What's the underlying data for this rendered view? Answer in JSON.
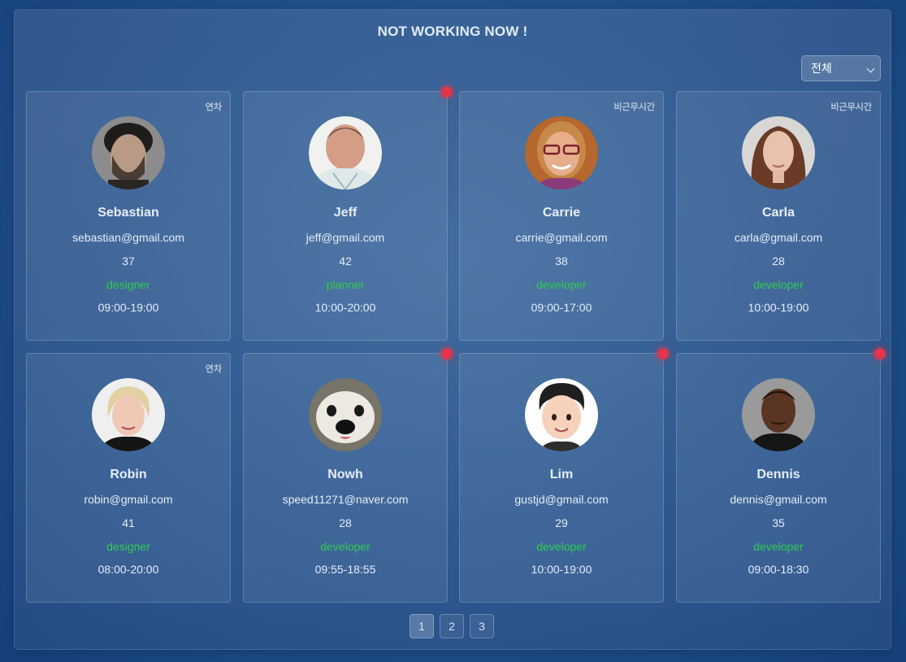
{
  "header": {
    "title": "NOT WORKING NOW !"
  },
  "filter": {
    "selected": "전체"
  },
  "employees": [
    {
      "name": "Sebastian",
      "email": "sebastian@gmail.com",
      "age": "37",
      "role": "designer",
      "hours": "09:00-19:00",
      "status": "연차",
      "alert": false,
      "avatar": "sebastian-avatar"
    },
    {
      "name": "Jeff",
      "email": "jeff@gmail.com",
      "age": "42",
      "role": "planner",
      "hours": "10:00-20:00",
      "status": "",
      "alert": true,
      "avatar": "jeff-avatar"
    },
    {
      "name": "Carrie",
      "email": "carrie@gmail.com",
      "age": "38",
      "role": "developer",
      "hours": "09:00-17:00",
      "status": "비근무시간",
      "alert": false,
      "avatar": "carrie-avatar"
    },
    {
      "name": "Carla",
      "email": "carla@gmail.com",
      "age": "28",
      "role": "developer",
      "hours": "10:00-19:00",
      "status": "비근무시간",
      "alert": false,
      "avatar": "carla-avatar"
    },
    {
      "name": "Robin",
      "email": "robin@gmail.com",
      "age": "41",
      "role": "designer",
      "hours": "08:00-20:00",
      "status": "연차",
      "alert": false,
      "avatar": "robin-avatar"
    },
    {
      "name": "Nowh",
      "email": "speed11271@naver.com",
      "age": "28",
      "role": "developer",
      "hours": "09:55-18:55",
      "status": "",
      "alert": true,
      "avatar": "dog-avatar"
    },
    {
      "name": "Lim",
      "email": "gustjd@gmail.com",
      "age": "29",
      "role": "developer",
      "hours": "10:00-19:00",
      "status": "",
      "alert": true,
      "avatar": "memoji-avatar"
    },
    {
      "name": "Dennis",
      "email": "dennis@gmail.com",
      "age": "35",
      "role": "developer",
      "hours": "09:00-18:30",
      "status": "",
      "alert": true,
      "avatar": "dennis-avatar"
    }
  ],
  "pagination": {
    "pages": [
      "1",
      "2",
      "3"
    ],
    "active": "1"
  },
  "colors": {
    "accent_role": "#2ecc4f",
    "alert_dot": "#e0354c",
    "background": "#1f4d88"
  }
}
